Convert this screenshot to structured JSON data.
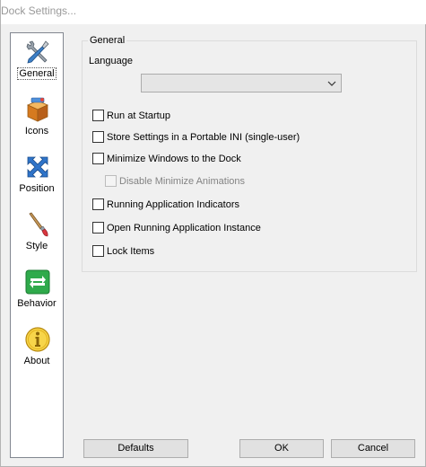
{
  "window": {
    "title": "Dock Settings..."
  },
  "nav": {
    "items": [
      {
        "label": "General"
      },
      {
        "label": "Icons"
      },
      {
        "label": "Position"
      },
      {
        "label": "Style"
      },
      {
        "label": "Behavior"
      },
      {
        "label": "About"
      }
    ]
  },
  "general": {
    "group_title": "General",
    "language_label": "Language",
    "language_value": "",
    "options": [
      {
        "label": "Run at Startup",
        "checked": false
      },
      {
        "label": "Store Settings in a Portable INI (single-user)",
        "checked": false
      },
      {
        "label": "Minimize Windows to the Dock",
        "checked": false
      },
      {
        "label": "Disable Minimize Animations",
        "checked": false,
        "disabled": true
      },
      {
        "label": "Running Application Indicators",
        "checked": false
      },
      {
        "label": "Open Running Application Instance",
        "checked": false
      },
      {
        "label": "Lock Items",
        "checked": false
      }
    ]
  },
  "buttons": {
    "defaults": "Defaults",
    "ok": "OK",
    "cancel": "Cancel"
  }
}
